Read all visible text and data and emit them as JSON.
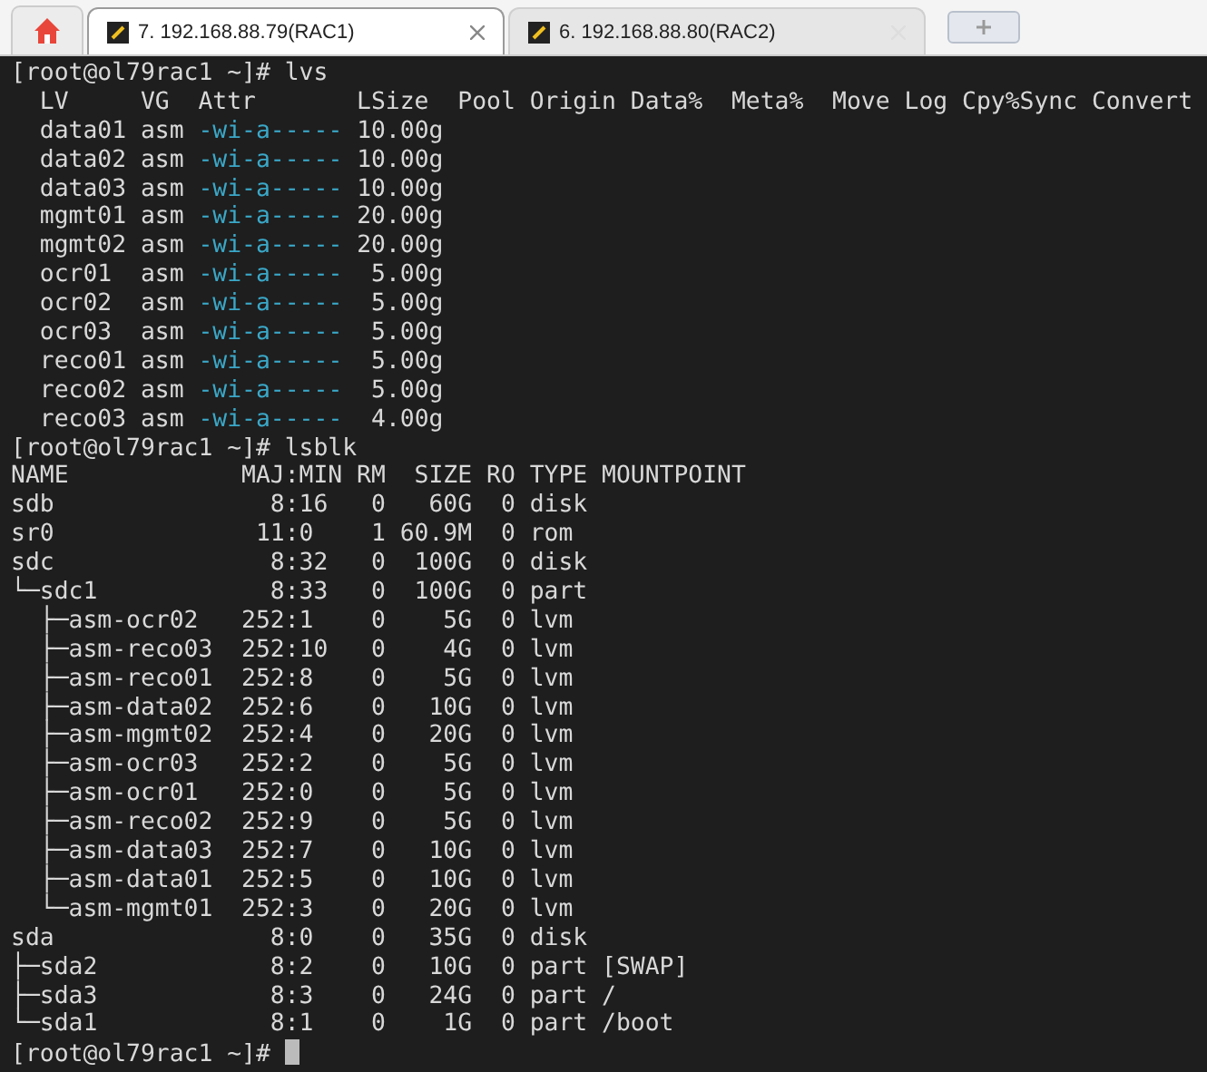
{
  "tabs": [
    {
      "label": "7. 192.168.88.79(RAC1)",
      "selected": true
    },
    {
      "label": "6. 192.168.88.80(RAC2)",
      "selected": false
    }
  ],
  "terminal": {
    "lines": [
      {
        "kind": "text",
        "text": "[root@ol79rac1 ~]# lvs"
      },
      {
        "kind": "text",
        "text": "  LV     VG  Attr       LSize  Pool Origin Data%  Meta%  Move Log Cpy%Sync Convert"
      },
      {
        "kind": "lv",
        "lv": "data01",
        "vg": "asm",
        "attr": "-wi-a-----",
        "lsize": "10.00g"
      },
      {
        "kind": "lv",
        "lv": "data02",
        "vg": "asm",
        "attr": "-wi-a-----",
        "lsize": "10.00g"
      },
      {
        "kind": "lv",
        "lv": "data03",
        "vg": "asm",
        "attr": "-wi-a-----",
        "lsize": "10.00g"
      },
      {
        "kind": "lv",
        "lv": "mgmt01",
        "vg": "asm",
        "attr": "-wi-a-----",
        "lsize": "20.00g"
      },
      {
        "kind": "lv",
        "lv": "mgmt02",
        "vg": "asm",
        "attr": "-wi-a-----",
        "lsize": "20.00g"
      },
      {
        "kind": "lv",
        "lv": "ocr01",
        "vg": "asm",
        "attr": "-wi-a-----",
        "lsize": "5.00g"
      },
      {
        "kind": "lv",
        "lv": "ocr02",
        "vg": "asm",
        "attr": "-wi-a-----",
        "lsize": "5.00g"
      },
      {
        "kind": "lv",
        "lv": "ocr03",
        "vg": "asm",
        "attr": "-wi-a-----",
        "lsize": "5.00g"
      },
      {
        "kind": "lv",
        "lv": "reco01",
        "vg": "asm",
        "attr": "-wi-a-----",
        "lsize": "5.00g"
      },
      {
        "kind": "lv",
        "lv": "reco02",
        "vg": "asm",
        "attr": "-wi-a-----",
        "lsize": "5.00g"
      },
      {
        "kind": "lv",
        "lv": "reco03",
        "vg": "asm",
        "attr": "-wi-a-----",
        "lsize": "4.00g"
      },
      {
        "kind": "text",
        "text": "[root@ol79rac1 ~]# lsblk"
      },
      {
        "kind": "text",
        "text": "NAME            MAJ:MIN RM  SIZE RO TYPE MOUNTPOINT"
      },
      {
        "kind": "text",
        "text": "sdb               8:16   0   60G  0 disk"
      },
      {
        "kind": "text",
        "text": "sr0              11:0    1 60.9M  0 rom"
      },
      {
        "kind": "text",
        "text": "sdc               8:32   0  100G  0 disk"
      },
      {
        "kind": "text",
        "text": "└─sdc1            8:33   0  100G  0 part"
      },
      {
        "kind": "text",
        "text": "  ├─asm-ocr02   252:1    0    5G  0 lvm"
      },
      {
        "kind": "text",
        "text": "  ├─asm-reco03  252:10   0    4G  0 lvm"
      },
      {
        "kind": "text",
        "text": "  ├─asm-reco01  252:8    0    5G  0 lvm"
      },
      {
        "kind": "text",
        "text": "  ├─asm-data02  252:6    0   10G  0 lvm"
      },
      {
        "kind": "text",
        "text": "  ├─asm-mgmt02  252:4    0   20G  0 lvm"
      },
      {
        "kind": "text",
        "text": "  ├─asm-ocr03   252:2    0    5G  0 lvm"
      },
      {
        "kind": "text",
        "text": "  ├─asm-ocr01   252:0    0    5G  0 lvm"
      },
      {
        "kind": "text",
        "text": "  ├─asm-reco02  252:9    0    5G  0 lvm"
      },
      {
        "kind": "text",
        "text": "  ├─asm-data03  252:7    0   10G  0 lvm"
      },
      {
        "kind": "text",
        "text": "  ├─asm-data01  252:5    0   10G  0 lvm"
      },
      {
        "kind": "text",
        "text": "  └─asm-mgmt01  252:3    0   20G  0 lvm"
      },
      {
        "kind": "text",
        "text": "sda               8:0    0   35G  0 disk"
      },
      {
        "kind": "text",
        "text": "├─sda2            8:2    0   10G  0 part [SWAP]"
      },
      {
        "kind": "text",
        "text": "├─sda3            8:3    0   24G  0 part /"
      },
      {
        "kind": "text",
        "text": "└─sda1            8:1    0    1G  0 part /boot"
      },
      {
        "kind": "prompt",
        "text": "[root@ol79rac1 ~]# "
      }
    ]
  }
}
